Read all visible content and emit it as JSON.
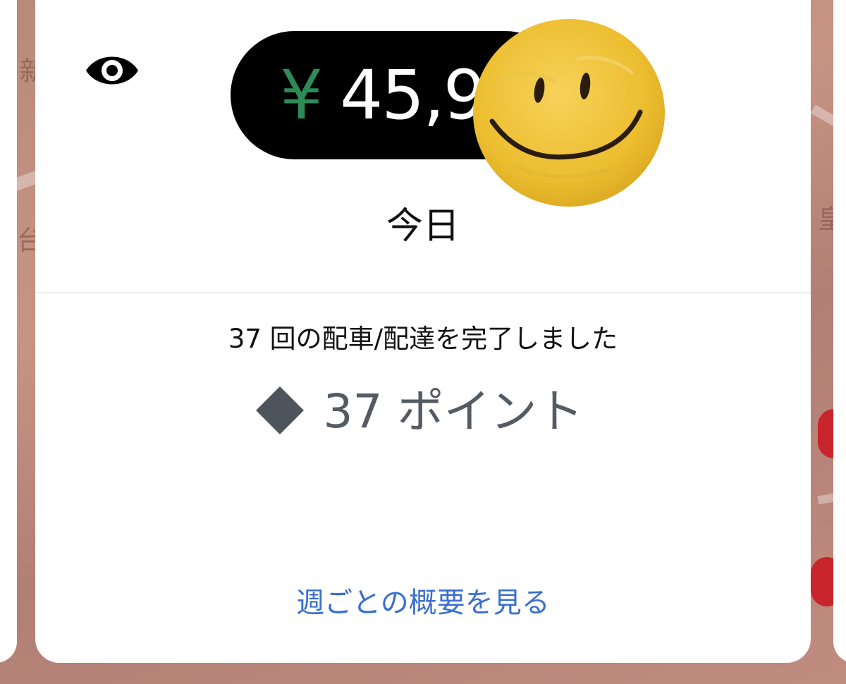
{
  "earnings": {
    "currency_symbol": "¥",
    "amount_visible": "45,9",
    "period": "今日"
  },
  "stats": {
    "trips_completed_text": "37 回の配車/配達を完了しました",
    "points_text": "37 ポイント"
  },
  "links": {
    "weekly_summary": "週ごとの概要を見る"
  },
  "icons": {
    "visibility": "eye-icon",
    "points": "diamond-icon",
    "overlay": "smiley-face-sticker"
  },
  "colors": {
    "accent_link": "#3a6fd0",
    "currency_green": "#2e8b57",
    "pill_background": "#000000",
    "points_grey": "#555b63"
  }
}
